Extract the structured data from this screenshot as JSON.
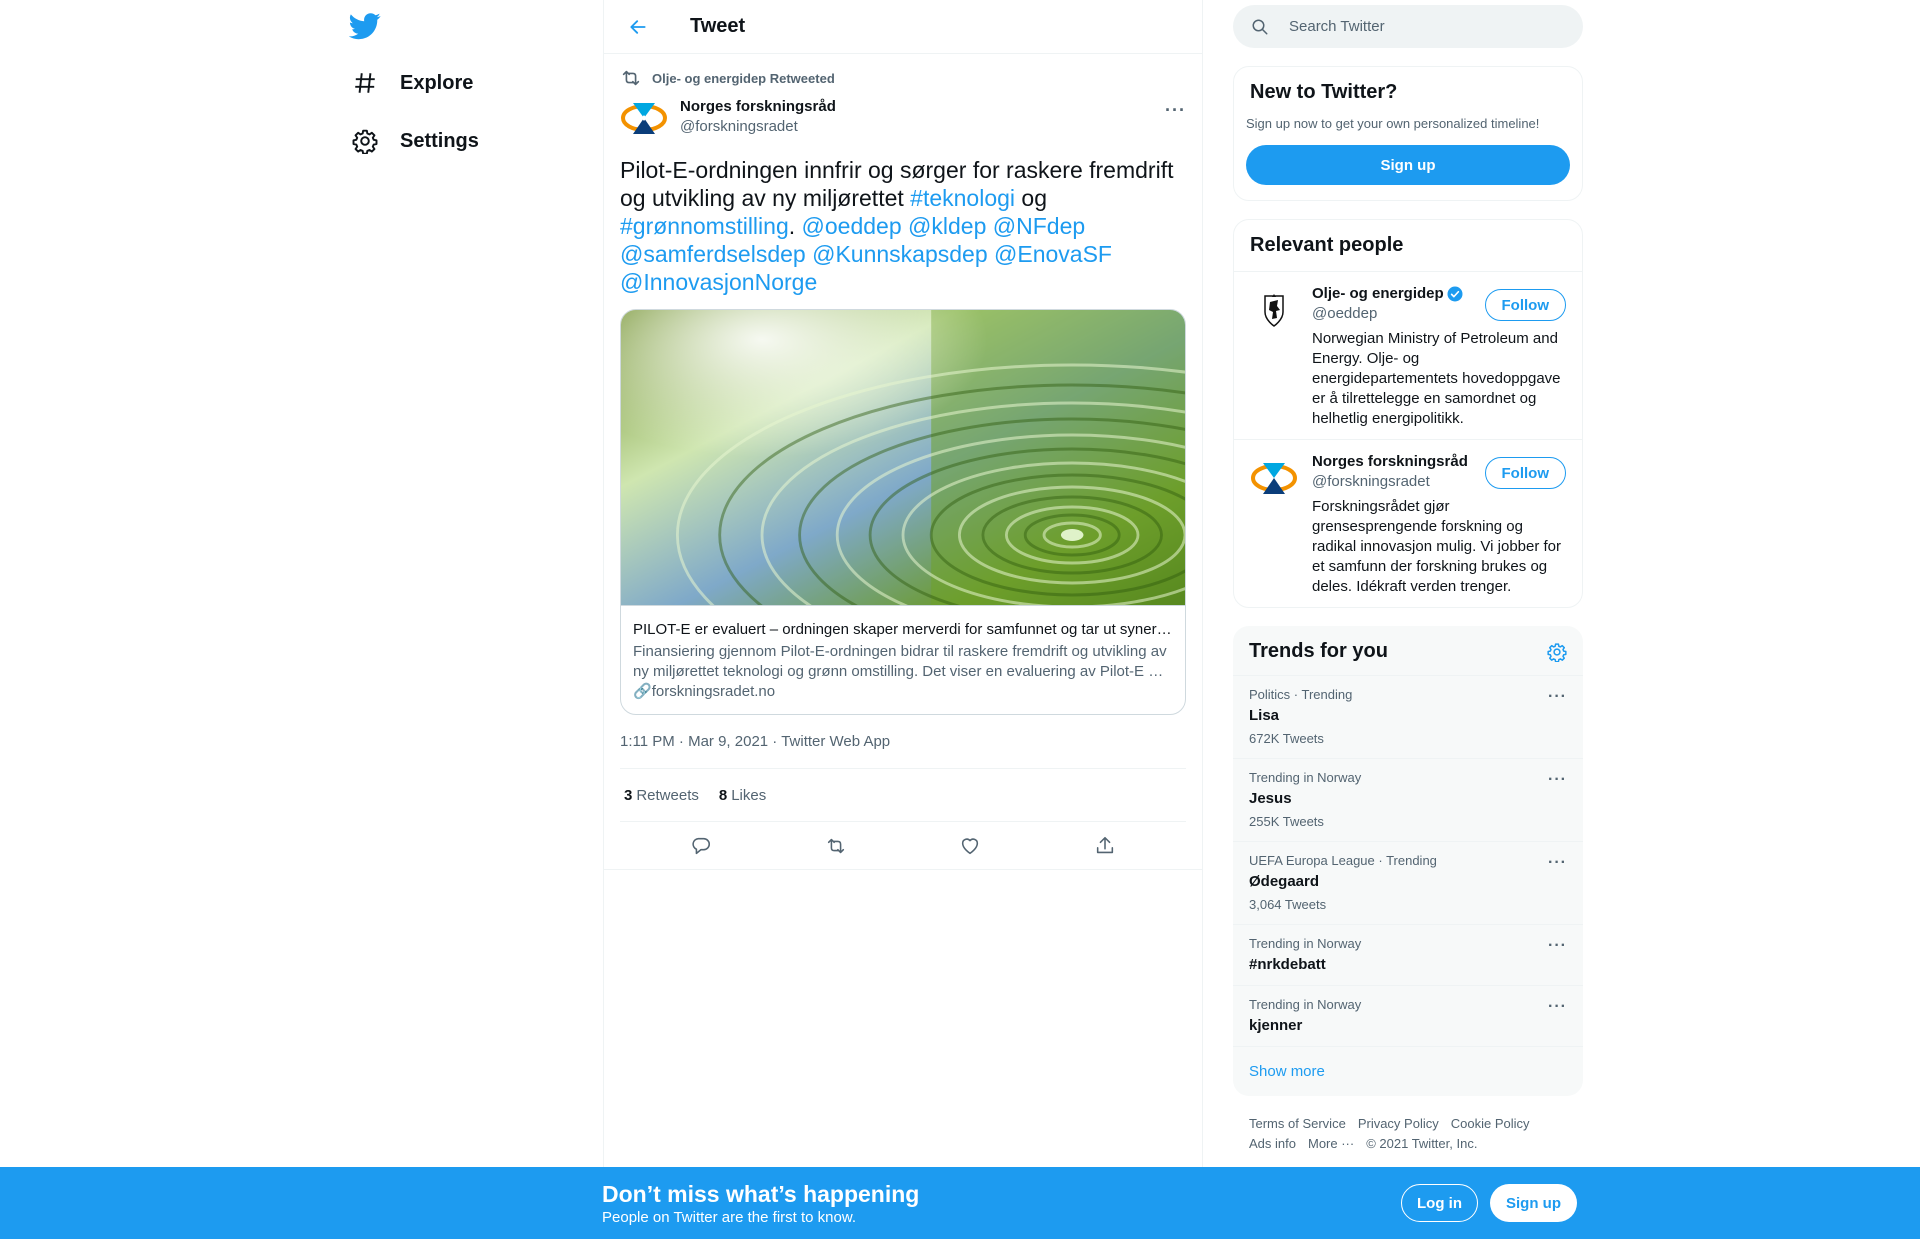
{
  "colors": {
    "accent": "#1d9bf0",
    "text": "#0f1419",
    "muted": "#536471"
  },
  "nav": {
    "logo_icon": "twitter-bird-icon",
    "items": [
      {
        "label": "Explore",
        "icon": "hashtag-icon"
      },
      {
        "label": "Settings",
        "icon": "gear-icon"
      }
    ]
  },
  "header": {
    "title": "Tweet",
    "back_icon": "arrow-left-icon"
  },
  "tweet": {
    "retweeted_by": "Olje- og energidep Retweeted",
    "author_name": "Norges forskningsråd",
    "author_handle": "@forskningsradet",
    "text_parts": [
      {
        "text": "Pilot-E-ordningen innfrir og sørger for raskere fremdrift og utvikling av ny miljørettet ",
        "link": false
      },
      {
        "text": "#teknologi",
        "link": true
      },
      {
        "text": " og ",
        "link": false
      },
      {
        "text": "#grønnomstilling",
        "link": true
      },
      {
        "text": ". ",
        "link": false
      },
      {
        "text": "@oeddep",
        "link": true
      },
      {
        "text": " ",
        "link": false
      },
      {
        "text": "@kldep",
        "link": true
      },
      {
        "text": " ",
        "link": false
      },
      {
        "text": "@NFdep",
        "link": true
      },
      {
        "text": " ",
        "link": false
      },
      {
        "text": "@samferdselsdep",
        "link": true
      },
      {
        "text": " ",
        "link": false
      },
      {
        "text": "@Kunnskapsdep",
        "link": true
      },
      {
        "text": " ",
        "link": false
      },
      {
        "text": "@EnovaSF",
        "link": true
      },
      {
        "text": " ",
        "link": false
      },
      {
        "text": "@InnovasjonNorge",
        "link": true
      }
    ],
    "card": {
      "title": "PILOT-E er evaluert – ordningen skaper merverdi for samfunnet og tar ut synergier",
      "description": "Finansiering gjennom Pilot-E-ordningen bidrar til raskere fremdrift og utvikling av ny miljørettet teknologi og grønn omstilling. Det viser en evaluering av Pilot-E …",
      "domain": "forskningsradet.no"
    },
    "timestamp": "1:11 PM · Mar 9, 2021",
    "separator": " · ",
    "source": "Twitter Web App",
    "retweets_count": "3",
    "retweets_label": "Retweets",
    "likes_count": "8",
    "likes_label": "Likes"
  },
  "search": {
    "placeholder": "Search Twitter"
  },
  "new_to_twitter": {
    "title": "New to Twitter?",
    "subtitle": "Sign up now to get your own personalized timeline!",
    "button": "Sign up"
  },
  "relevant_people": {
    "title": "Relevant people",
    "people": [
      {
        "name": "Olje- og energidep",
        "handle": "@oeddep",
        "verified": true,
        "follow_label": "Follow",
        "bio": "Norwegian Ministry of Petroleum and Energy. Olje- og energidepartementets hovedoppgave er å tilrettelegge en samordnet og helhetlig energipolitikk."
      },
      {
        "name": "Norges forskningsråd",
        "handle": "@forskningsradet",
        "verified": false,
        "follow_label": "Follow",
        "bio": "Forskningsrådet gjør grensesprengende forskning og radikal innovasjon mulig. Vi jobber for et samfunn der forskning brukes og deles. Idékraft verden trenger."
      }
    ]
  },
  "trends": {
    "title": "Trends for you",
    "items": [
      {
        "context": "Politics · Trending",
        "name": "Lisa",
        "count": "672K Tweets"
      },
      {
        "context": "Trending in Norway",
        "name": "Jesus",
        "count": "255K Tweets"
      },
      {
        "context": "UEFA Europa League · Trending",
        "name": "Ødegaard",
        "count": "3,064 Tweets"
      },
      {
        "context": "Trending in Norway",
        "name": "#nrkdebatt",
        "count": ""
      },
      {
        "context": "Trending in Norway",
        "name": "kjenner",
        "count": ""
      }
    ],
    "show_more": "Show more"
  },
  "footer": {
    "links": [
      "Terms of Service",
      "Privacy Policy",
      "Cookie Policy",
      "Ads info",
      "More ···"
    ],
    "copyright": "© 2021 Twitter, Inc."
  },
  "bottom_bar": {
    "title": "Don’t miss what’s happening",
    "subtitle": "People on Twitter are the first to know.",
    "login": "Log in",
    "signup": "Sign up"
  }
}
